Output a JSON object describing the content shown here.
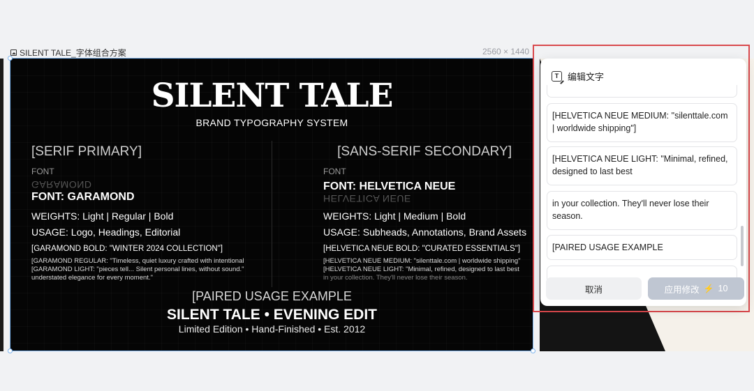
{
  "frame": {
    "name": "SILENT TALE_字体组合方案",
    "size": "2560 × 1440"
  },
  "poster": {
    "title": "SILENT TALE",
    "subtitle": "BRAND TYPOGRAPHY SYSTEM",
    "left": {
      "heading": "[SERIF PRIMARY]",
      "label": "FONT",
      "ghost": "GARAMOND",
      "font": "FONT: GARAMOND",
      "weights": "WEIGHTS: Light | Regular | Bold",
      "usage": "USAGE:  Logo, Headings, Editorial",
      "bold_quote": "[GARAMOND BOLD: \"WINTER 2024 COLLECTION\"]",
      "regular_quote": "[GARAMOND REGULAR: \"Timeless, quiet luxury crafted with intentional",
      "light_quote": "[GARAMOND LIGHT: \"pieces tell... Silent personal lines, without sound.\"",
      "light_quote_2": "understated elegance for every moment.\""
    },
    "right": {
      "heading": "[SANS-SERIF SECONDARY]",
      "label": "FONT",
      "font": "FONT:   HELVETICA NEUE",
      "ghost": "HELVETICA NEUE",
      "weights": "WEIGHTS: Light | Medium | Bold",
      "usage": "USAGE: Subheads, Annotations, Brand Assets",
      "bold_quote": "[HELVETICA NEUE BOLD: \"CURATED ESSENTIALS\"]",
      "medium_quote": "[HELVETICA NEUE MEDIUM: \"silenttale.com | worldwide shipping\"",
      "light_quote": "[HELVETICA NEUE LIGHT: \"Minimal, refined, designed to last best",
      "light_quote_2": "in your collection. They'll never lose their season."
    },
    "paired": "[PAIRED USAGE EXAMPLE",
    "evening": "SILENT TALE • EVENING EDIT",
    "limited": "Limited Edition • Hand-Finished • Est. 2012"
  },
  "panel": {
    "title": "编辑文字",
    "cards": [
      "",
      "[HELVETICA NEUE MEDIUM: \"silenttale.com | worldwide shipping\"]",
      "[HELVETICA NEUE LIGHT: \"Minimal, refined, designed to last best",
      "in your collection. They'll never lose their season.",
      "[PAIRED USAGE EXAMPLE",
      ""
    ],
    "cancel": "取消",
    "apply": "应用修改",
    "credits": "10"
  },
  "colors": {
    "highlight_border": "#d9484c",
    "selection": "#7cb4ee",
    "apply_button": "#bfc6d2"
  }
}
